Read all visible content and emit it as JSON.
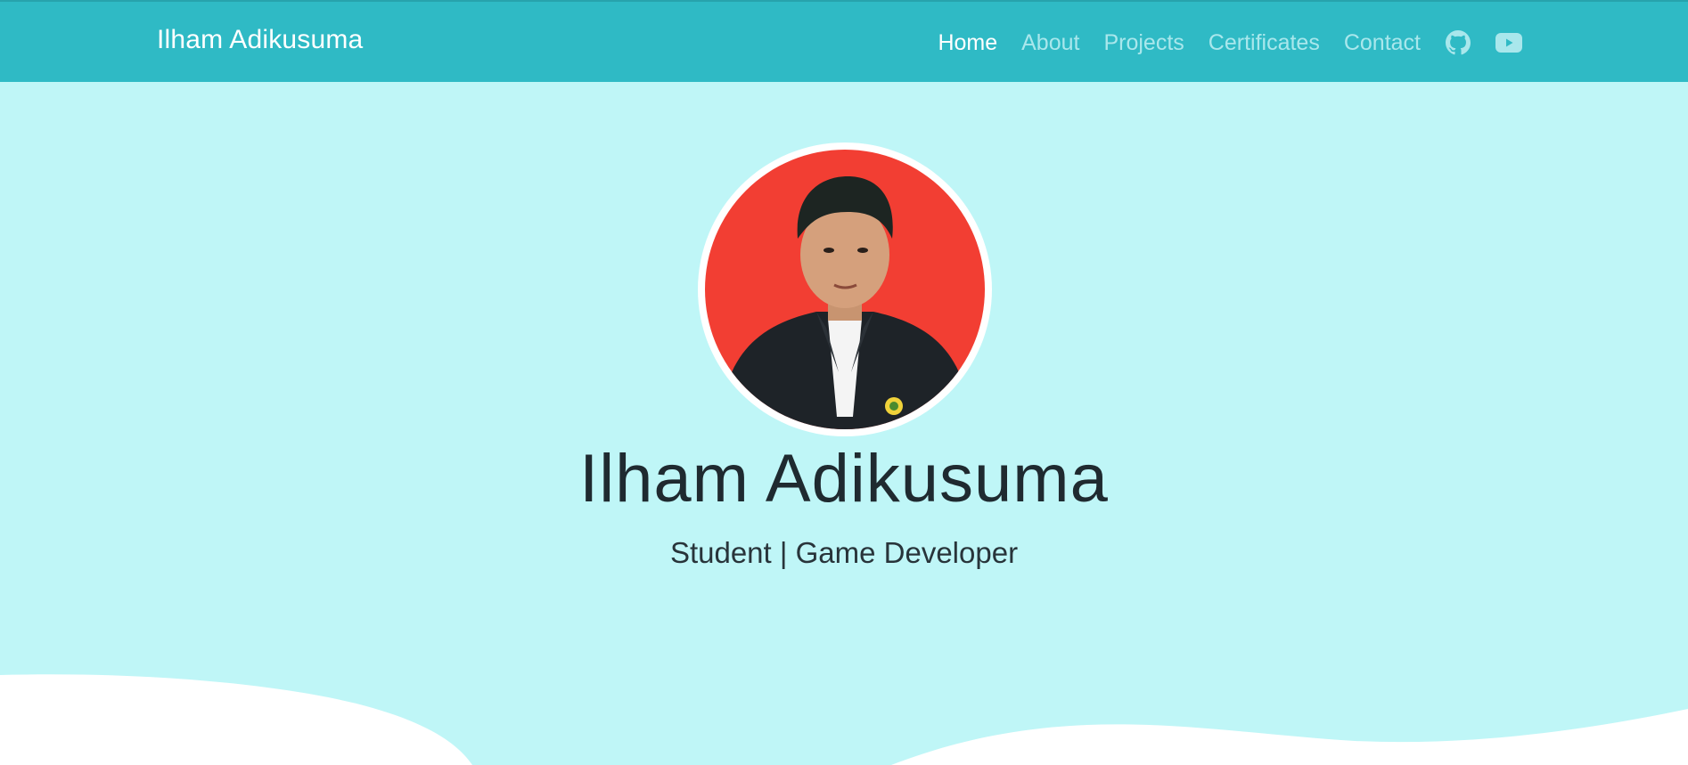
{
  "navbar": {
    "brand": "Ilham Adikusuma",
    "links": [
      {
        "label": "Home",
        "active": true
      },
      {
        "label": "About",
        "active": false
      },
      {
        "label": "Projects",
        "active": false
      },
      {
        "label": "Certificates",
        "active": false
      },
      {
        "label": "Contact",
        "active": false
      }
    ],
    "icons": [
      "github-icon",
      "youtube-icon"
    ]
  },
  "hero": {
    "name": "Ilham Adikusuma",
    "tagline": "Student | Game Developer",
    "avatar": "profile-photo"
  },
  "colors": {
    "navbar": "#2fbac5",
    "hero_bg": "#bff6f7",
    "nav_link": "#a9e7ec",
    "nav_active": "#ffffff",
    "photo_bg": "#f23e33"
  }
}
